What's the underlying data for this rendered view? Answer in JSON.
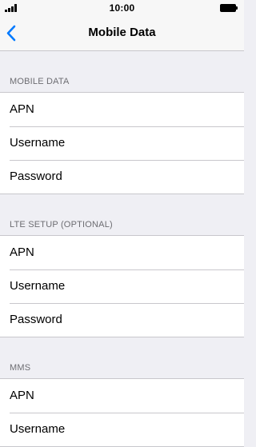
{
  "status_bar": {
    "time": "10:00"
  },
  "nav": {
    "title": "Mobile Data",
    "back_icon": "chevron-left-icon",
    "accent_color": "#007aff"
  },
  "sections": [
    {
      "header": "MOBILE DATA",
      "rows": [
        {
          "label": "APN"
        },
        {
          "label": "Username"
        },
        {
          "label": "Password"
        }
      ]
    },
    {
      "header": "LTE SETUP (OPTIONAL)",
      "rows": [
        {
          "label": "APN"
        },
        {
          "label": "Username"
        },
        {
          "label": "Password"
        }
      ]
    },
    {
      "header": "MMS",
      "rows": [
        {
          "label": "APN"
        },
        {
          "label": "Username"
        }
      ]
    }
  ]
}
